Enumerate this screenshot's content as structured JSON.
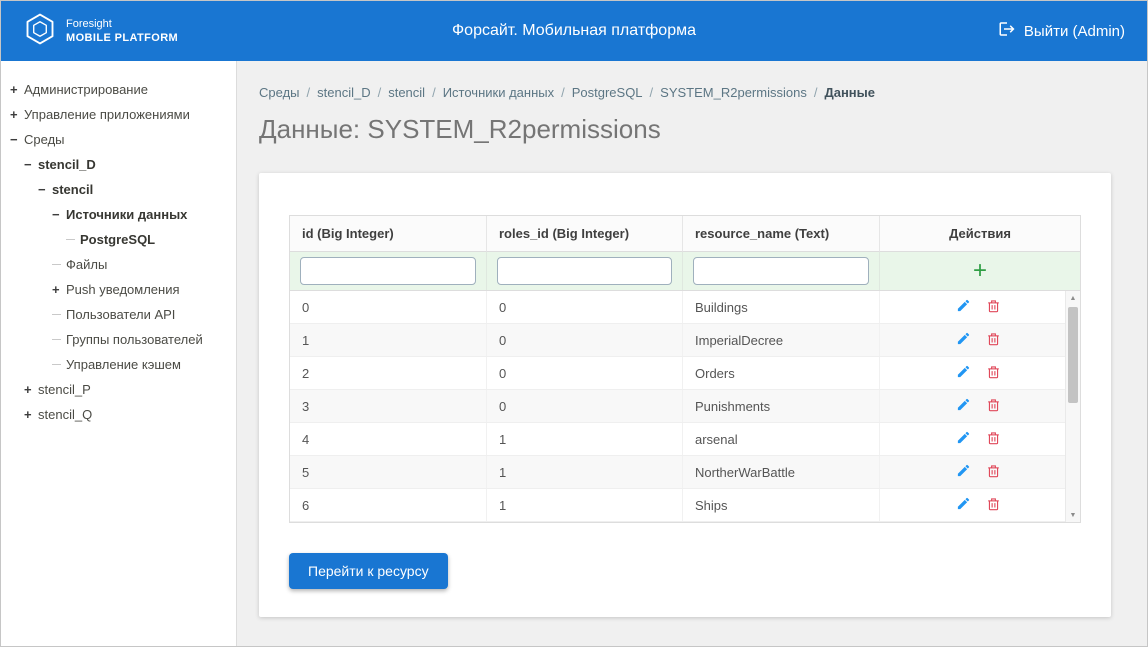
{
  "colors": {
    "header_blue": "#1976d2",
    "accent_blue": "#1976d2",
    "add_green": "#2f9e44",
    "edit_blue": "#2196f3",
    "delete_red": "#e0485a",
    "filter_row_bg": "#e9f6e9"
  },
  "header": {
    "logo_icon": "foresight-hexagon-logo",
    "logo_line1": "Foresight",
    "logo_line2": "MOBILE PLATFORM",
    "title": "Форсайт. Мобильная платформа",
    "logout": {
      "icon": "logout-icon",
      "label": "Выйти (Admin)"
    }
  },
  "sidebar": {
    "items": [
      {
        "label": "Администрирование",
        "expander": "+",
        "level": 0,
        "bold": false
      },
      {
        "label": "Управление приложениями",
        "expander": "+",
        "level": 0,
        "bold": false
      },
      {
        "label": "Среды",
        "expander": "-",
        "level": 0,
        "bold": false
      },
      {
        "label": "stencil_D",
        "expander": "-",
        "level": 1,
        "bold": true
      },
      {
        "label": "stencil",
        "expander": "-",
        "level": 2,
        "bold": true
      },
      {
        "label": "Источники данных",
        "expander": "-",
        "level": 3,
        "bold": true
      },
      {
        "label": "PostgreSQL",
        "expander": "",
        "level": 4,
        "bold": true
      },
      {
        "label": "Файлы",
        "expander": "",
        "level": 3,
        "bold": false
      },
      {
        "label": "Push уведомления",
        "expander": "+",
        "level": 3,
        "bold": false
      },
      {
        "label": "Пользователи API",
        "expander": "",
        "level": 3,
        "bold": false
      },
      {
        "label": "Группы пользователей",
        "expander": "",
        "level": 3,
        "bold": false
      },
      {
        "label": "Управление кэшем",
        "expander": "",
        "level": 3,
        "bold": false
      },
      {
        "label": "stencil_P",
        "expander": "+",
        "level": 1,
        "bold": false
      },
      {
        "label": "stencil_Q",
        "expander": "+",
        "level": 1,
        "bold": false
      }
    ]
  },
  "breadcrumb": {
    "items": [
      "Среды",
      "stencil_D",
      "stencil",
      "Источники данных",
      "PostgreSQL",
      "SYSTEM_R2permissions",
      "Данные"
    ]
  },
  "page": {
    "title": "Данные: SYSTEM_R2permissions"
  },
  "table": {
    "columns": [
      "id (Big Integer)",
      "roles_id (Big Integer)",
      "resource_name (Text)",
      "Действия"
    ],
    "filters": [
      "",
      "",
      ""
    ],
    "add_icon": "plus-icon",
    "row_action_icons": [
      "pencil-icon",
      "trash-icon"
    ],
    "rows": [
      [
        "0",
        "0",
        "Buildings"
      ],
      [
        "1",
        "0",
        "ImperialDecree"
      ],
      [
        "2",
        "0",
        "Orders"
      ],
      [
        "3",
        "0",
        "Punishments"
      ],
      [
        "4",
        "1",
        "arsenal"
      ],
      [
        "5",
        "1",
        "NortherWarBattle"
      ],
      [
        "6",
        "1",
        "Ships"
      ]
    ]
  },
  "footer_button": {
    "label": "Перейти к ресурсу"
  }
}
